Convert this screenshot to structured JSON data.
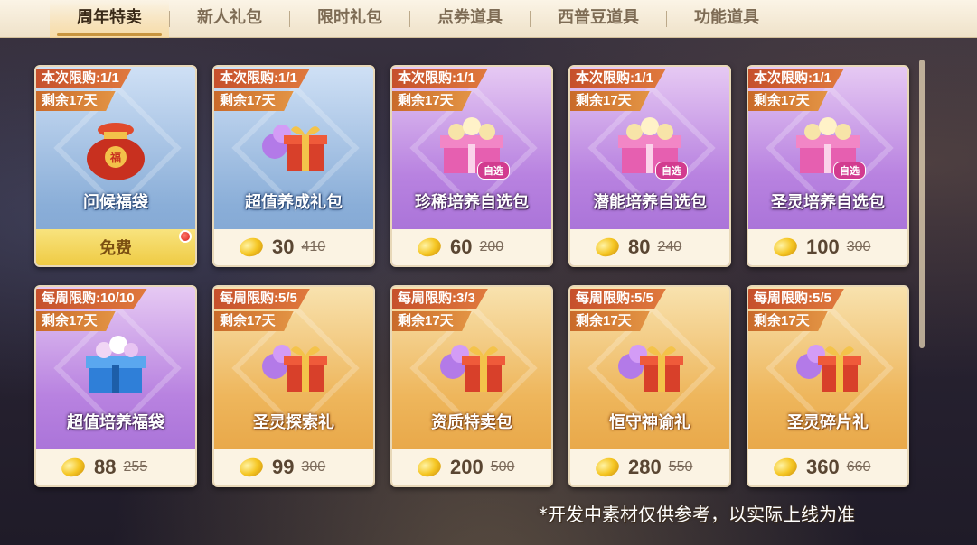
{
  "tabs": [
    {
      "label": "周年特卖",
      "active": true
    },
    {
      "label": "新人礼包",
      "active": false
    },
    {
      "label": "限时礼包",
      "active": false
    },
    {
      "label": "点券道具",
      "active": false
    },
    {
      "label": "西普豆道具",
      "active": false
    },
    {
      "label": "功能道具",
      "active": false
    }
  ],
  "cards": [
    {
      "limit": "本次限购:1/1",
      "remain": "剩余17天",
      "name": "问候福袋",
      "price": "",
      "original": "",
      "free_label": "免费",
      "theme": "blue",
      "icon": "lucky-bag-icon",
      "selectable": false
    },
    {
      "limit": "本次限购:1/1",
      "remain": "剩余17天",
      "name": "超值养成礼包",
      "price": "30",
      "original": "410",
      "theme": "blue",
      "icon": "gift-box-icon",
      "selectable": false
    },
    {
      "limit": "本次限购:1/1",
      "remain": "剩余17天",
      "name": "珍稀培养自选包",
      "price": "60",
      "original": "200",
      "theme": "purple",
      "icon": "pink-chest-icon",
      "selectable": true
    },
    {
      "limit": "本次限购:1/1",
      "remain": "剩余17天",
      "name": "潜能培养自选包",
      "price": "80",
      "original": "240",
      "theme": "purple",
      "icon": "pink-chest-icon",
      "selectable": true
    },
    {
      "limit": "本次限购:1/1",
      "remain": "剩余17天",
      "name": "圣灵培养自选包",
      "price": "100",
      "original": "300",
      "theme": "purple",
      "icon": "pink-chest-icon",
      "selectable": true
    },
    {
      "limit": "每周限购:10/10",
      "remain": "剩余17天",
      "name": "超值培养福袋",
      "price": "88",
      "original": "255",
      "theme": "purple",
      "icon": "blue-chest-icon",
      "selectable": false
    },
    {
      "limit": "每周限购:5/5",
      "remain": "剩余17天",
      "name": "圣灵探索礼",
      "price": "99",
      "original": "300",
      "theme": "gold",
      "icon": "gift-box-icon",
      "selectable": false
    },
    {
      "limit": "每周限购:3/3",
      "remain": "剩余17天",
      "name": "资质特卖包",
      "price": "200",
      "original": "500",
      "theme": "gold",
      "icon": "gift-box-icon",
      "selectable": false
    },
    {
      "limit": "每周限购:5/5",
      "remain": "剩余17天",
      "name": "恒守神谕礼",
      "price": "280",
      "original": "550",
      "theme": "gold",
      "icon": "gift-box-icon",
      "selectable": false
    },
    {
      "limit": "每周限购:5/5",
      "remain": "剩余17天",
      "name": "圣灵碎片礼",
      "price": "360",
      "original": "660",
      "theme": "gold",
      "icon": "gift-box-icon",
      "selectable": false
    }
  ],
  "select_badge": "自选",
  "disclaimer": "*开发中素材仅供参考，以实际上线为准",
  "colors": {
    "accent": "#c9953f",
    "blue_card": "#8aaed8",
    "purple_card": "#b882e0",
    "gold_card": "#eeb65c"
  }
}
